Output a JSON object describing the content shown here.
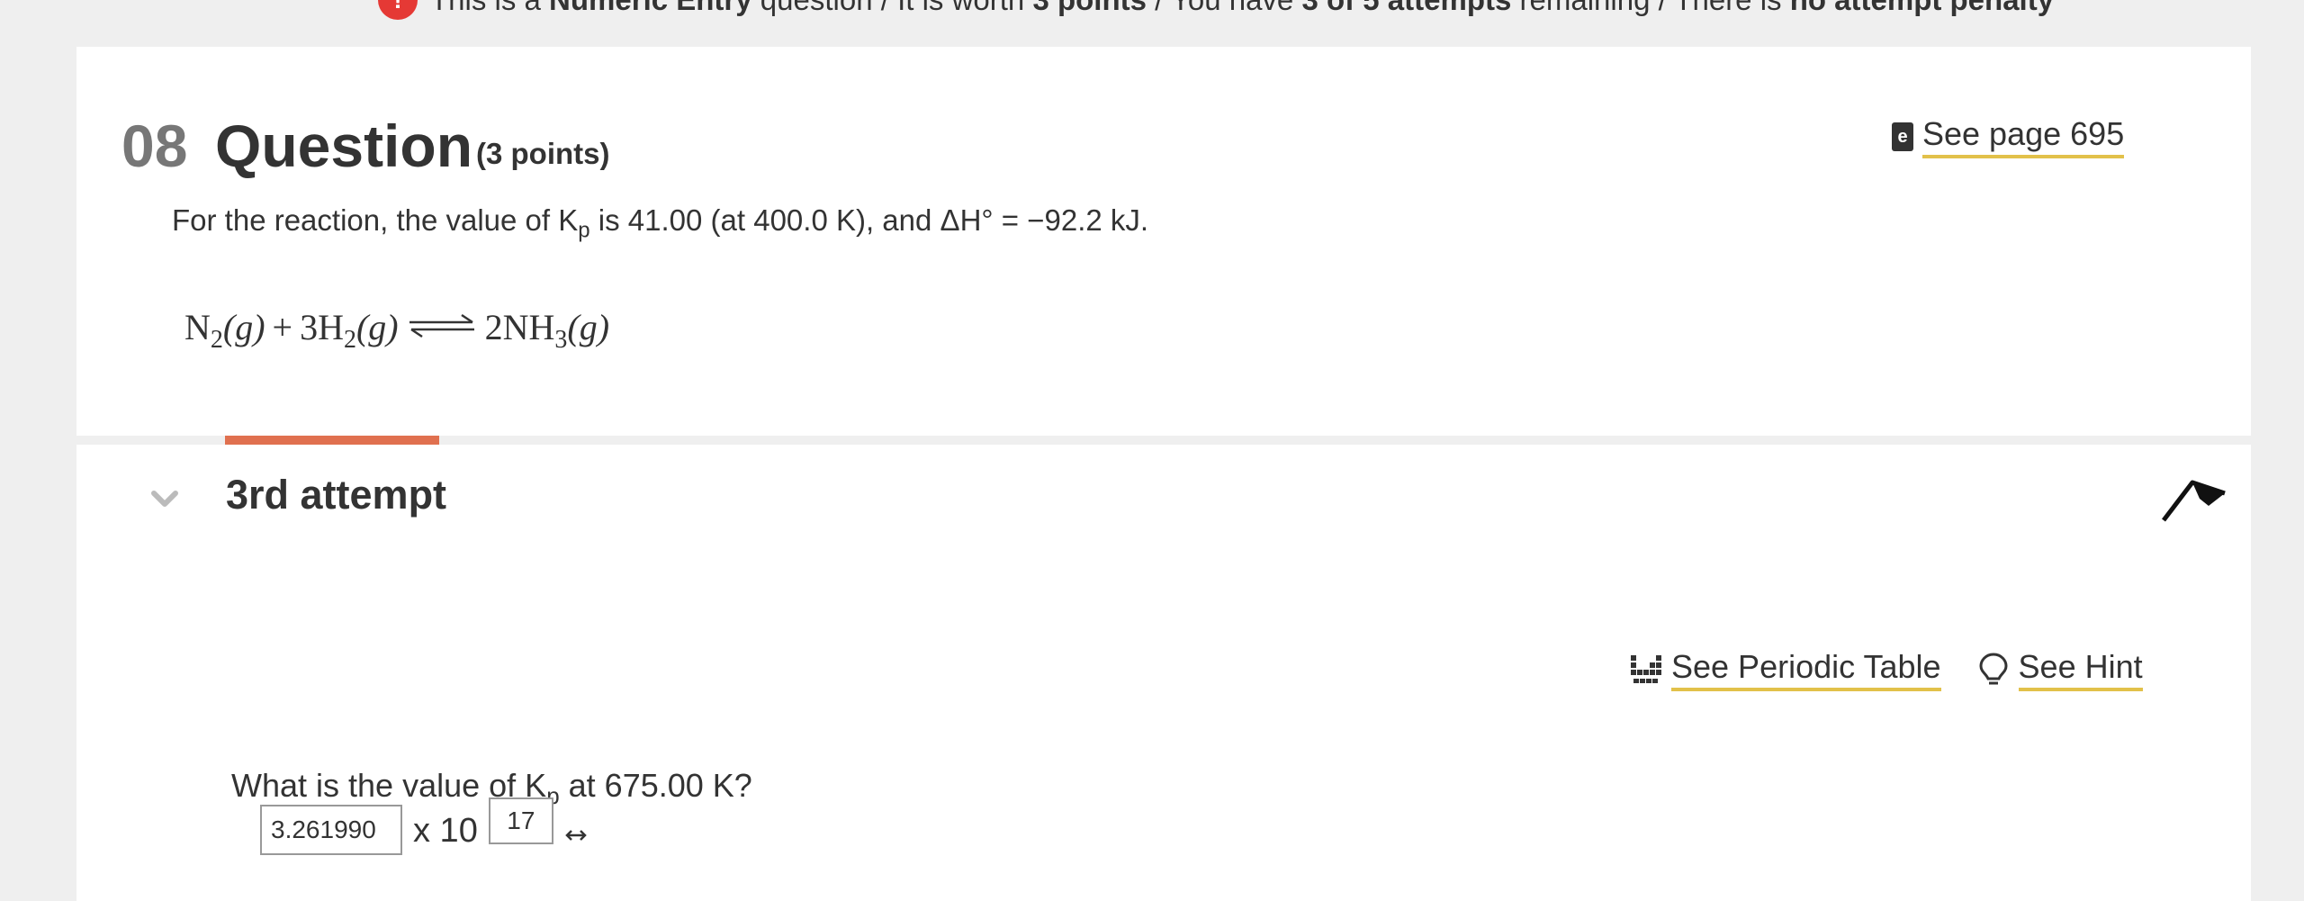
{
  "banner": {
    "icon": "alert-icon",
    "text_1": "This is a ",
    "type": "Numeric Entry",
    "text_2": " question / It is worth ",
    "points": "3 points",
    "text_3": " / You have ",
    "attempts": "3 of 5 attempts",
    "text_4": " remaining / There is ",
    "penalty": "no attempt penalty"
  },
  "question": {
    "number": "08",
    "title": "Question",
    "points": "(3 points)",
    "see_page": "See page 695",
    "prompt_pre": "For the reaction, the value of K",
    "prompt_sub": "p",
    "prompt_post": " is 41.00 (at 400.0 K), and ΔH° = −92.2 kJ.",
    "equation": {
      "r1": "N",
      "r1_sub": "2",
      "r1_state": "(g)",
      "plus": "+",
      "r2": "3H",
      "r2_sub": "2",
      "r2_state": "(g)",
      "p1": "2NH",
      "p1_sub": "3",
      "p1_state": "(g)"
    }
  },
  "attempt": {
    "title": "3rd attempt",
    "periodic_table": "See Periodic Table",
    "hint": "See Hint",
    "subq_pre": "What is the value of K",
    "subq_sub": "p",
    "subq_post": " at 675.00  K?",
    "answer_value": "3.261990",
    "times_label": "x 10",
    "exponent_value": "17"
  },
  "colors": {
    "accent": "#e0704f",
    "link_underline": "#e2c14a",
    "alert": "#e53935"
  }
}
